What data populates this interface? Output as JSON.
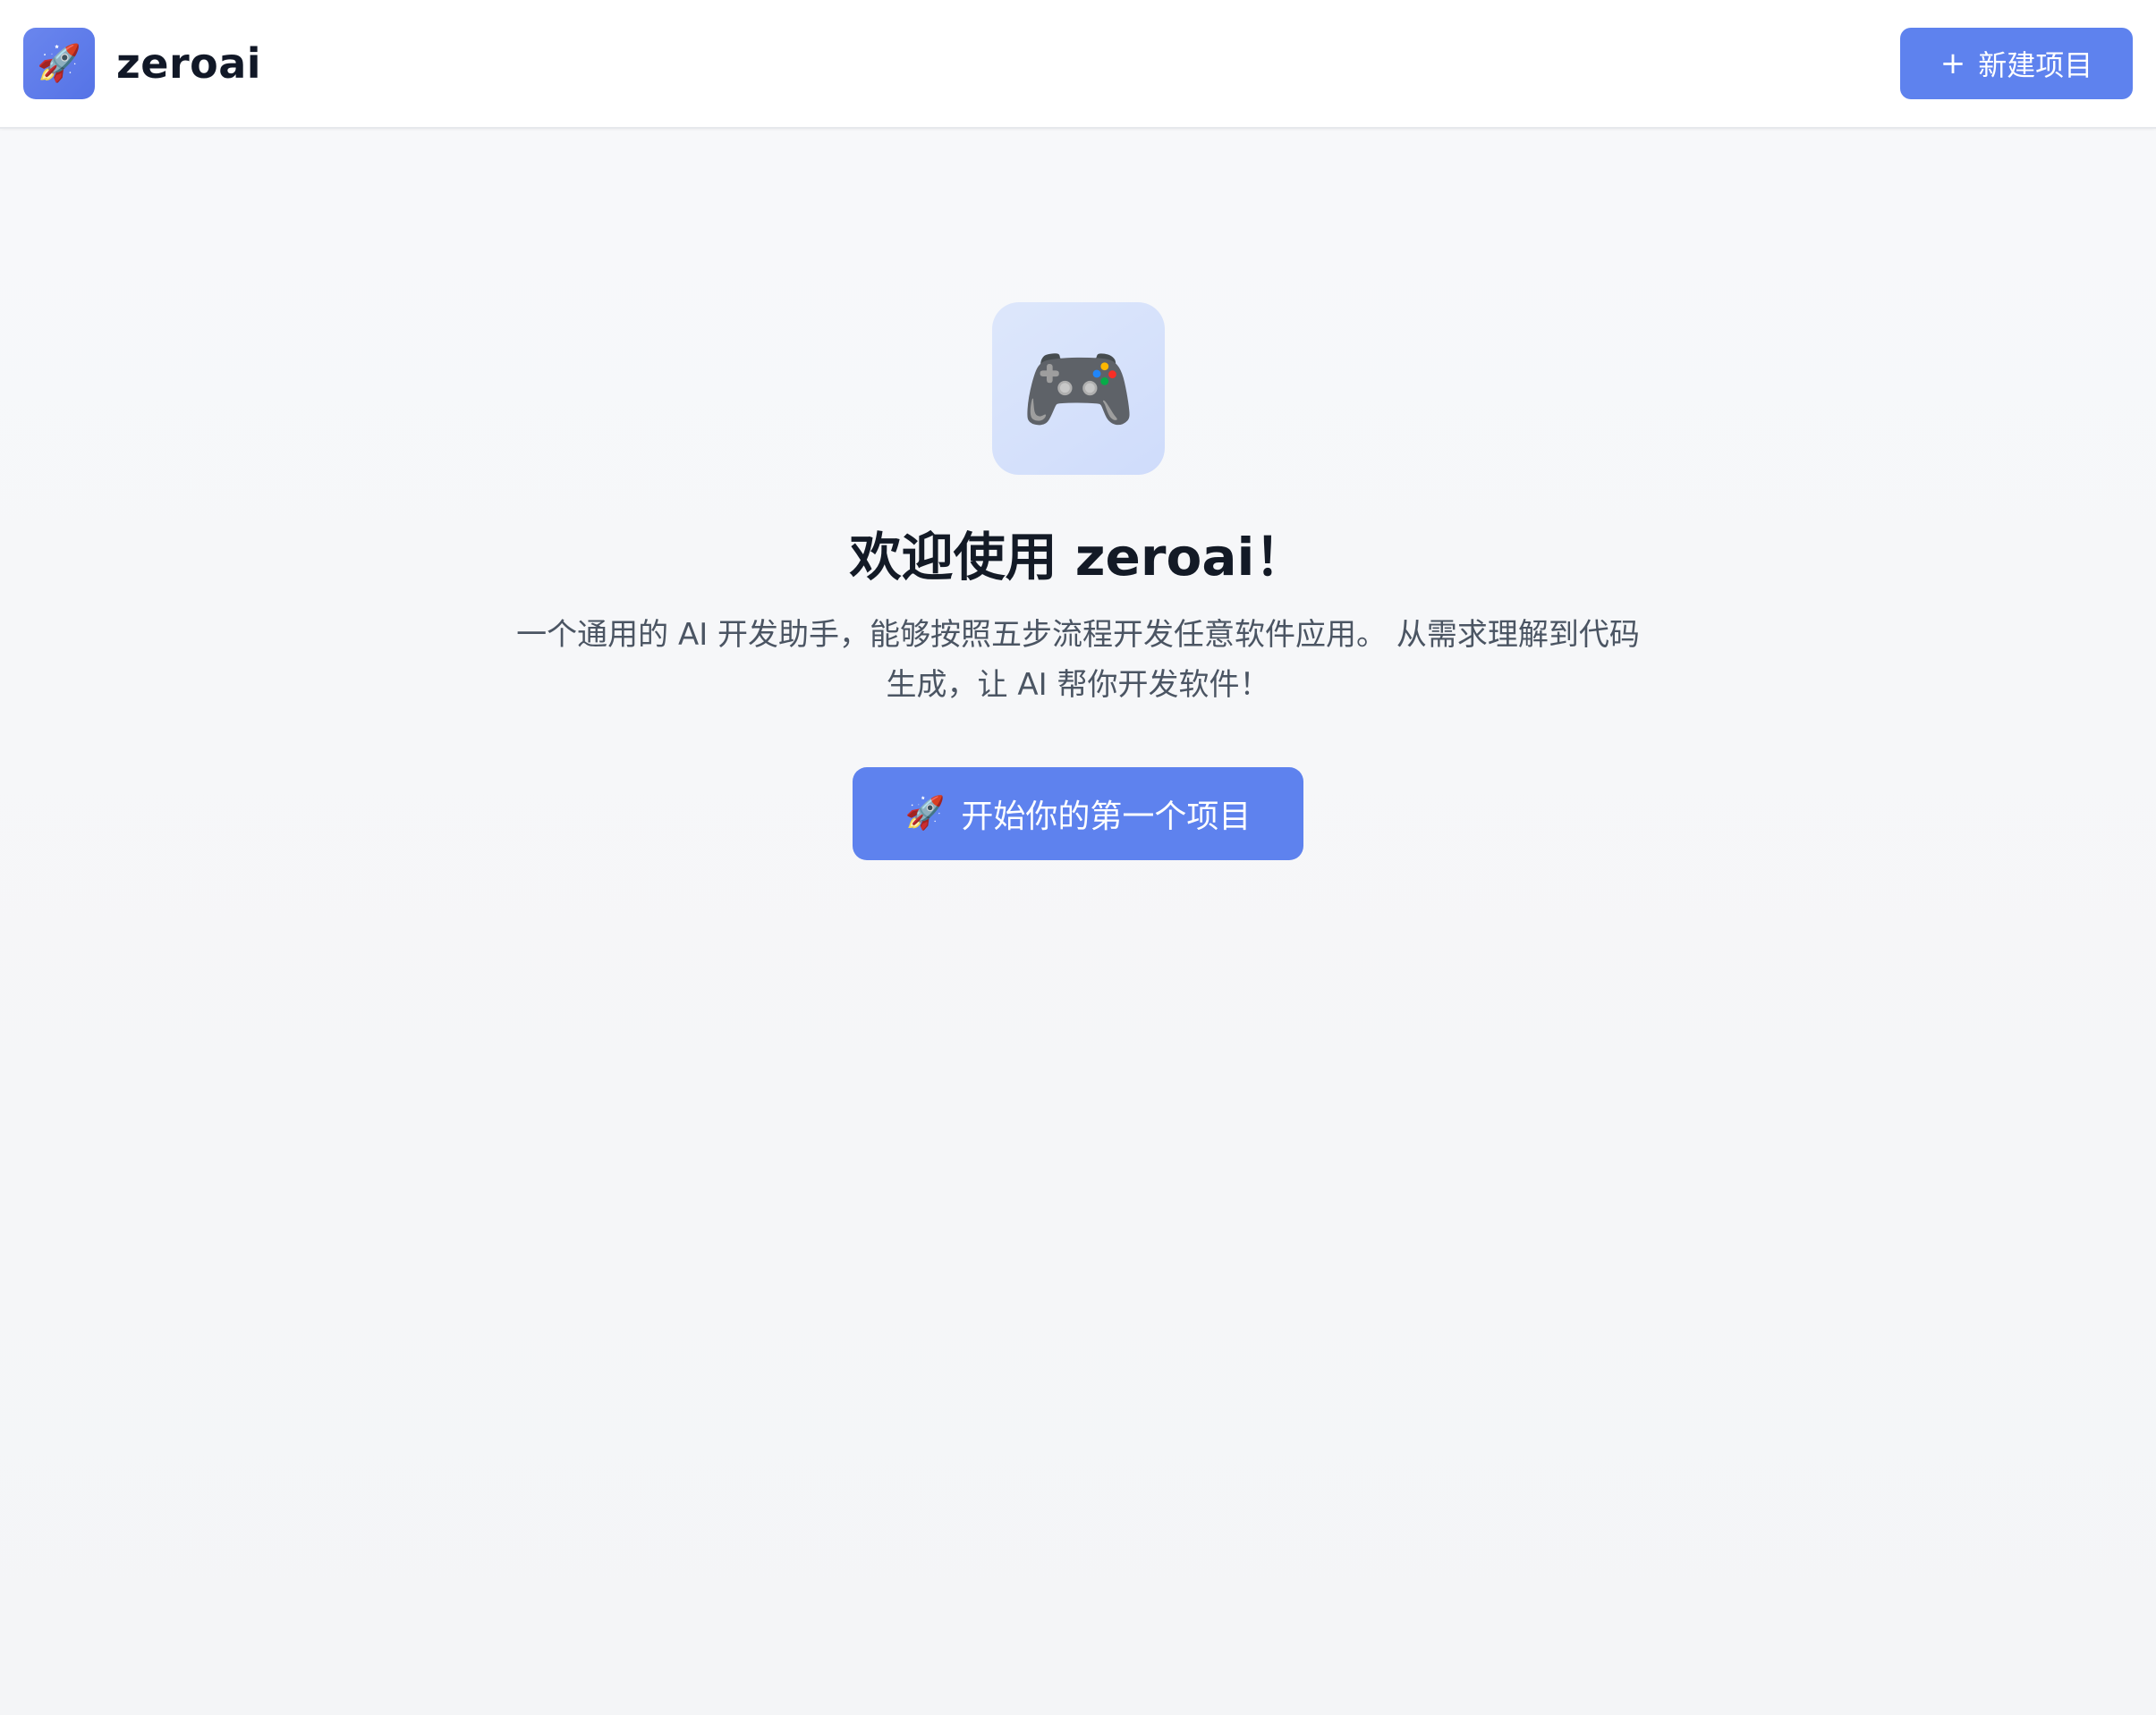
{
  "header": {
    "logo_icon": "🚀",
    "brand_name": "zeroai",
    "new_project_icon": "+",
    "new_project_label": "新建项目"
  },
  "main": {
    "hero_icon": "🎮",
    "title": "欢迎使用 zeroai！",
    "description_line1": "一个通用的 AI 开发助手，能够按照五步流程开发任意软件应用。 从需求理解到代码",
    "description_line2": "生成，让 AI 帮你开发软件！",
    "cta_icon": "🚀",
    "cta_label": "开始你的第一个项目"
  },
  "colors": {
    "accent": "#5e82ee",
    "background": "#f6f7f9",
    "header_bg": "#ffffff",
    "title_text": "#131a26",
    "body_text": "#4b5563"
  }
}
